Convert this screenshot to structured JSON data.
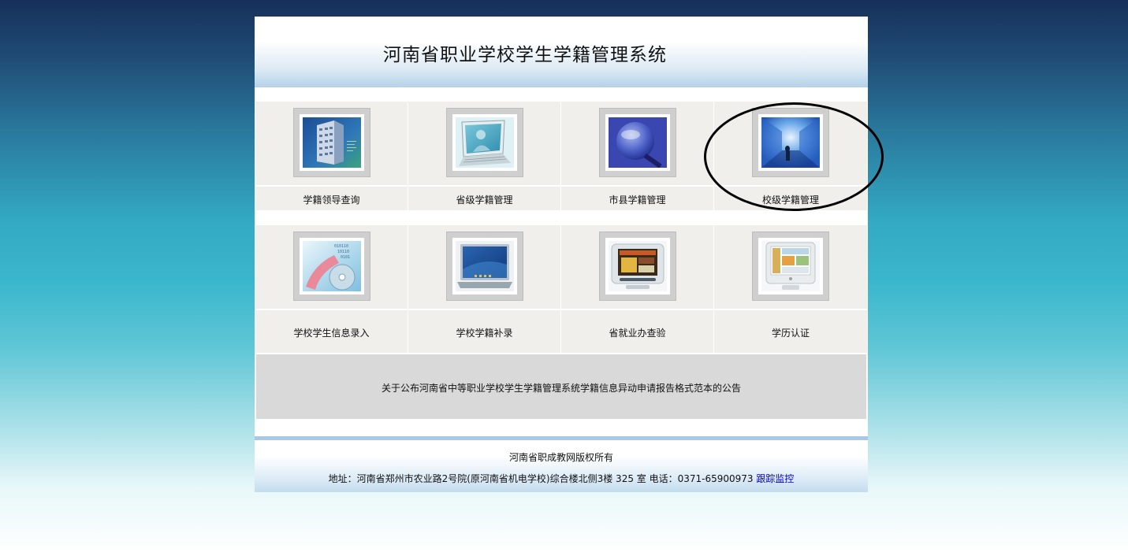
{
  "header": {
    "title": "河南省职业学校学生学籍管理系统"
  },
  "modules_row1": [
    {
      "label": "学籍领导查询",
      "icon": "building-icon"
    },
    {
      "label": "省级学籍管理",
      "icon": "monitor-person-icon"
    },
    {
      "label": "市县学籍管理",
      "icon": "magnifier-icon"
    },
    {
      "label": "校级学籍管理",
      "icon": "corridor-icon"
    }
  ],
  "modules_row2": [
    {
      "label": "学校学生信息录入",
      "icon": "data-disc-icon"
    },
    {
      "label": "学校学籍补录",
      "icon": "laptop-icon"
    },
    {
      "label": "省就业办查验",
      "icon": "crt-monitor-icon"
    },
    {
      "label": "学历认证",
      "icon": "imac-icon"
    }
  ],
  "notice": {
    "text": "关于公布河南省中等职业学校学生学籍管理系统学籍信息异动申请报告格式范本的公告"
  },
  "footer": {
    "copyright": "河南省职成教网版权所有",
    "address": "地址：河南省郑州市农业路2号院(原河南省机电学校)综合楼北侧3楼 325 室 电话：0371-65900973",
    "tracking_link": "跟踪监控"
  },
  "colors": {
    "notice_bg": "#d9d9d9",
    "tile_bg": "#f0efec",
    "link": "#0000cc",
    "footer_bar": "#a9c9e2"
  }
}
